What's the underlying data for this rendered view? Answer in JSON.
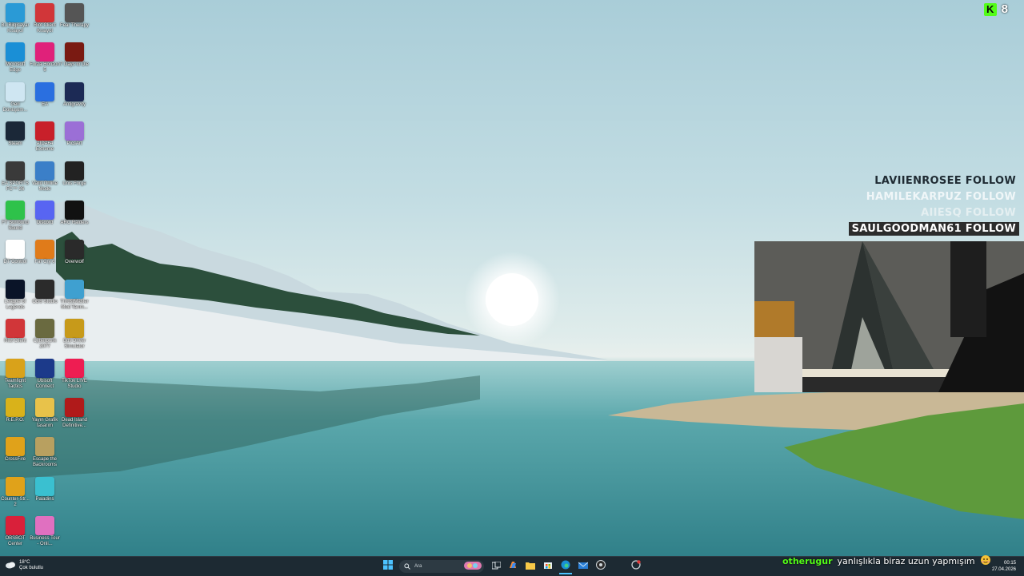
{
  "desktop": {
    "icons": [
      {
        "label": "Bu Bilgisayar Kısayol",
        "icon": "monitor-icon",
        "color": "#2a9ad6"
      },
      {
        "label": "Riot Client Kısayol",
        "icon": "riot-icon",
        "color": "#d13639"
      },
      {
        "label": "Fear Therapy",
        "icon": "fear-therapy-icon",
        "color": "#555555"
      },
      {
        "label": "Microsoft Edge",
        "icon": "edge-icon",
        "color": "#1a8fd6"
      },
      {
        "label": "Forza Horizon 5",
        "icon": "forza-icon",
        "color": "#e0217a"
      },
      {
        "label": "7 Days to Die",
        "icon": "7days-icon",
        "color": "#7a1a12"
      },
      {
        "label": "Geri Dönüşüm...",
        "icon": "recycle-bin-icon",
        "color": "#cfe6f2"
      },
      {
        "label": "EA",
        "icon": "ea-icon",
        "color": "#2a6fe0"
      },
      {
        "label": "Antigravity",
        "icon": "antigravity-icon",
        "color": "#1c2a55"
      },
      {
        "label": "Steam",
        "icon": "steam-icon",
        "color": "#1b2838"
      },
      {
        "label": "AIDA64 Extreme",
        "icon": "aida64-icon",
        "color": "#c8202a"
      },
      {
        "label": "PicsArt",
        "icon": "picsart-icon",
        "color": "#9b6fd6"
      },
      {
        "label": "EA SPORTS FC™ 26",
        "icon": "fc26-icon",
        "color": "#3a3a3a"
      },
      {
        "label": "Valid Online Mode",
        "icon": "valid-icon",
        "color": "#3b7fc8"
      },
      {
        "label": "Unis Forge",
        "icon": "forge-icon",
        "color": "#222222"
      },
      {
        "label": "FT Surround Sound",
        "icon": "surround-icon",
        "color": "#2ec24a"
      },
      {
        "label": "Discord",
        "icon": "discord-icon",
        "color": "#5865f2"
      },
      {
        "label": "ARC Raiders",
        "icon": "arc-raiders-icon",
        "color": "#111111"
      },
      {
        "label": "DT Control",
        "icon": "dt-control-icon",
        "color": "#ffffff"
      },
      {
        "label": "Far Cry 6",
        "icon": "farcry-icon",
        "color": "#e07b1a"
      },
      {
        "label": "Overwolf",
        "icon": "overwolf-icon",
        "color": "#2a2a2a"
      },
      {
        "label": "League of Legends",
        "icon": "lol-icon",
        "color": "#0a1428"
      },
      {
        "label": "OBS Studio",
        "icon": "obs-icon",
        "color": "#2b2b2b"
      },
      {
        "label": "ThrustMaster Mod Tarım...",
        "icon": "thrustmaster-icon",
        "color": "#3fa0d0"
      },
      {
        "label": "Riot Client",
        "icon": "riot-client-icon",
        "color": "#d13639"
      },
      {
        "label": "Cyberpunk 2077",
        "icon": "cyberpunk-icon",
        "color": "#6a6a40"
      },
      {
        "label": "Bus Driver Simulator",
        "icon": "bus-driver-icon",
        "color": "#c79a1a"
      },
      {
        "label": "Teamfight Tactics",
        "icon": "tft-icon",
        "color": "#d9a21a"
      },
      {
        "label": "Ubisoft Connect",
        "icon": "ubisoft-icon",
        "color": "#1c3a8a"
      },
      {
        "label": "TikTok LIVE Studio",
        "icon": "tiktok-icon",
        "color": "#ee1d52"
      },
      {
        "label": "R.E.P.O.",
        "icon": "repo-icon",
        "color": "#d9b21a"
      },
      {
        "label": "Yayın Grafik tasarım",
        "icon": "folder-icon",
        "color": "#e8c24a"
      },
      {
        "label": "Dead Island Definitive...",
        "icon": "dead-island-icon",
        "color": "#b01a1a"
      },
      {
        "label": "CrossFire",
        "icon": "crossfire-icon",
        "color": "#e0a21a"
      },
      {
        "label": "Escape the Backrooms",
        "icon": "backrooms-icon",
        "color": "#b8a060"
      },
      {
        "label": "",
        "icon": "empty-slot",
        "color": "transparent"
      },
      {
        "label": "Counter-Str... 2",
        "icon": "cs2-icon",
        "color": "#e0a21a"
      },
      {
        "label": "Paladins",
        "icon": "paladins-icon",
        "color": "#3ac0d0"
      },
      {
        "label": "",
        "icon": "empty-slot",
        "color": "transparent"
      },
      {
        "label": "OBSBOT Center",
        "icon": "obsbot-icon",
        "color": "#d9203a"
      },
      {
        "label": "Business Tour - Onli...",
        "icon": "business-tour-icon",
        "color": "#e070c0"
      }
    ]
  },
  "overlay": {
    "viewers": {
      "count": "8",
      "logo": "K",
      "brand_color": "#53fc18"
    },
    "follows": [
      {
        "name": "LAVIIENROSEE",
        "action": "FOLLOW",
        "style": "normal"
      },
      {
        "name": "HAMILEKARPUZ",
        "action": "FOLLOW",
        "style": "faded"
      },
      {
        "name": "AIIESQ",
        "action": "FOLLOW",
        "style": "muted"
      },
      {
        "name": "SAULGOODMAN61",
        "action": "FOLLOW",
        "style": "highlight"
      }
    ],
    "chat": {
      "user": "otherugur",
      "message": "yanlışlıkla biraz uzun yapmışım"
    }
  },
  "taskbar": {
    "weather": {
      "temp": "18°C",
      "condition": "Çok bulutlu"
    },
    "search": {
      "placeholder": "Ara"
    },
    "clock": {
      "time": "00:15",
      "date": "27.04.2026"
    },
    "accent": "#1d2a33"
  }
}
